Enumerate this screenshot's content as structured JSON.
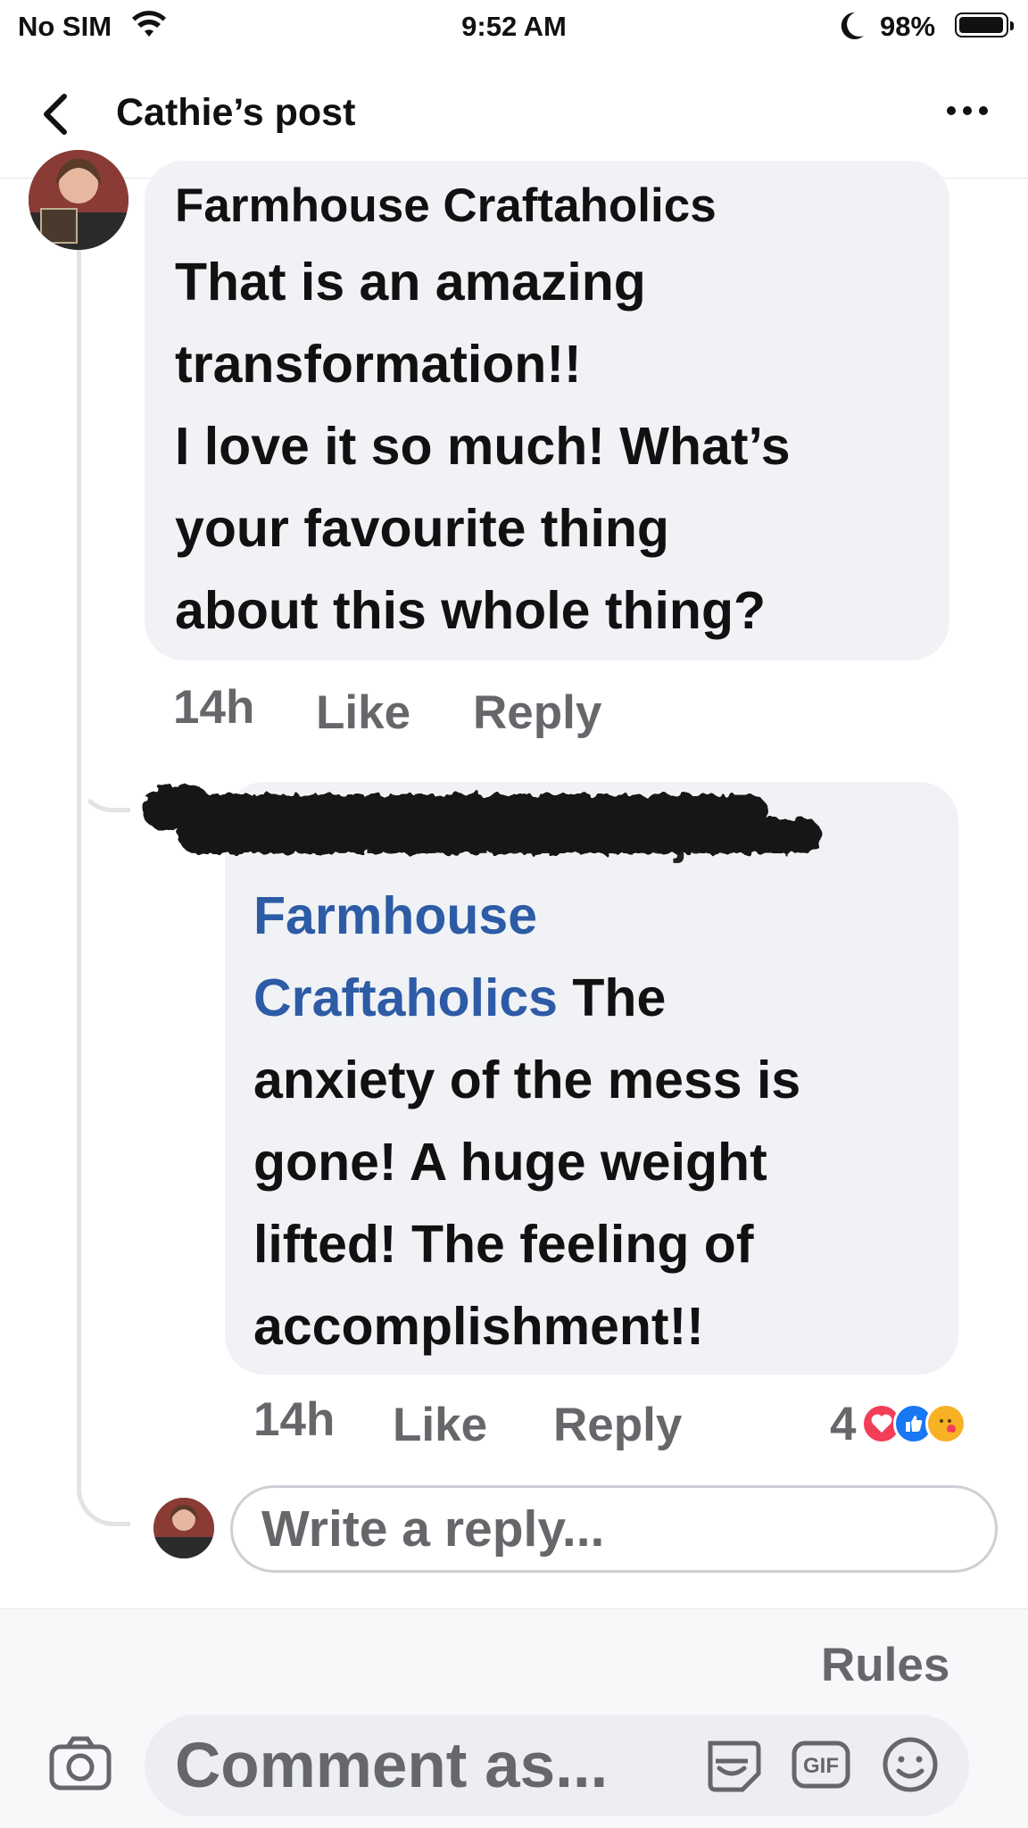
{
  "status_bar": {
    "carrier": "No SIM",
    "time": "9:52 AM",
    "battery": "98%",
    "battery_level": 0.98,
    "icons": [
      "wifi-icon",
      "moon-icon",
      "battery-icon"
    ]
  },
  "header": {
    "title": "Cathie’s post",
    "back_icon": "chevron-left-icon",
    "more_icon": "ellipsis-icon"
  },
  "comments": [
    {
      "author": "Farmhouse Craftaholics",
      "text_lines": [
        "That is an amazing",
        "transformation!!",
        "I love it so much! What’s",
        "your favourite thing",
        "about this whole thing?"
      ],
      "time": "14h",
      "like_label": "Like",
      "reply_label": "Reply"
    },
    {
      "author": "Cathie Di Fazio Rojas",
      "author_redacted": true,
      "mention_line_1": "Farmhouse",
      "mention_line_2": "Craftaholics",
      "text_line_2_rest": " The",
      "text_lines": [
        "anxiety of the mess is",
        "gone! A huge weight",
        "lifted! The feeling of",
        "accomplishment!!"
      ],
      "time": "14h",
      "like_label": "Like",
      "reply_label": "Reply",
      "reaction_count": "4",
      "reaction_icons": [
        "love-reaction-icon",
        "like-reaction-icon",
        "care-reaction-icon"
      ]
    }
  ],
  "reply_box": {
    "placeholder": "Write a reply..."
  },
  "composer": {
    "rules_label": "Rules",
    "placeholder": "Comment as...",
    "icons": [
      "camera-icon",
      "avatar-sticker-icon",
      "gif-icon",
      "emoji-icon"
    ],
    "gif_label": "GIF"
  },
  "colors": {
    "bubble": "#f0f2f5",
    "mention": "#2d5ba6",
    "secondary_text": "#65676b",
    "love": "#f33e58",
    "like": "#1877f2",
    "care": "#f7b125"
  }
}
